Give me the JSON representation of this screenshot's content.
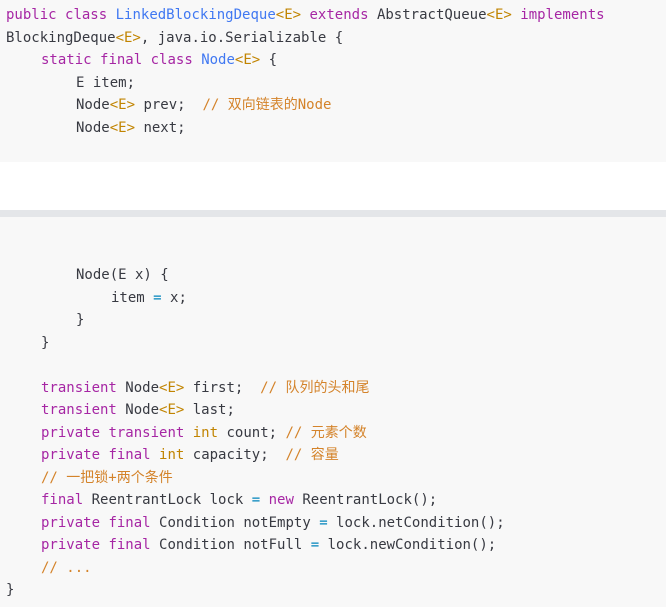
{
  "code_top": [
    {
      "indent": 0,
      "tokens": [
        {
          "t": "public",
          "c": "kw"
        },
        {
          "t": " "
        },
        {
          "t": "class",
          "c": "kw"
        },
        {
          "t": " "
        },
        {
          "t": "LinkedBlockingDeque",
          "c": "cls2"
        },
        {
          "t": "<E>",
          "c": "cls"
        },
        {
          "t": " "
        },
        {
          "t": "extends",
          "c": "kw"
        },
        {
          "t": " AbstractQueue"
        },
        {
          "t": "<E>",
          "c": "cls"
        },
        {
          "t": " "
        },
        {
          "t": "implements",
          "c": "kw"
        }
      ]
    },
    {
      "indent": 0,
      "tokens": [
        {
          "t": "BlockingDeque"
        },
        {
          "t": "<E>",
          "c": "cls"
        },
        {
          "t": ", java.io.Serializable {"
        }
      ]
    },
    {
      "indent": 1,
      "tokens": [
        {
          "t": "static",
          "c": "kw"
        },
        {
          "t": " "
        },
        {
          "t": "final",
          "c": "kw"
        },
        {
          "t": " "
        },
        {
          "t": "class",
          "c": "kw"
        },
        {
          "t": " "
        },
        {
          "t": "Node",
          "c": "cls2"
        },
        {
          "t": "<E>",
          "c": "cls"
        },
        {
          "t": " {"
        }
      ]
    },
    {
      "indent": 2,
      "tokens": [
        {
          "t": "E item;"
        }
      ]
    },
    {
      "indent": 2,
      "tokens": [
        {
          "t": "Node"
        },
        {
          "t": "<E>",
          "c": "cls"
        },
        {
          "t": " prev;  "
        },
        {
          "t": "// 双向链表的Node",
          "c": "cmt"
        }
      ]
    },
    {
      "indent": 2,
      "tokens": [
        {
          "t": "Node"
        },
        {
          "t": "<E>",
          "c": "cls"
        },
        {
          "t": " next;"
        }
      ]
    }
  ],
  "code_bottom": [
    {
      "indent": 2,
      "tokens": [
        {
          "t": "Node(E x) {"
        }
      ]
    },
    {
      "indent": 3,
      "tokens": [
        {
          "t": "item "
        },
        {
          "t": "=",
          "c": "op"
        },
        {
          "t": " x;"
        }
      ]
    },
    {
      "indent": 2,
      "tokens": [
        {
          "t": "}"
        }
      ]
    },
    {
      "indent": 1,
      "tokens": [
        {
          "t": "}"
        }
      ]
    },
    {
      "indent": 0,
      "tokens": [
        {
          "t": ""
        }
      ]
    },
    {
      "indent": 1,
      "tokens": [
        {
          "t": "transient",
          "c": "kw"
        },
        {
          "t": " Node"
        },
        {
          "t": "<E>",
          "c": "cls"
        },
        {
          "t": " first;  "
        },
        {
          "t": "// 队列的头和尾",
          "c": "cmt"
        }
      ]
    },
    {
      "indent": 1,
      "tokens": [
        {
          "t": "transient",
          "c": "kw"
        },
        {
          "t": " Node"
        },
        {
          "t": "<E>",
          "c": "cls"
        },
        {
          "t": " last;"
        }
      ]
    },
    {
      "indent": 1,
      "tokens": [
        {
          "t": "private",
          "c": "kw"
        },
        {
          "t": " "
        },
        {
          "t": "transient",
          "c": "kw"
        },
        {
          "t": " "
        },
        {
          "t": "int",
          "c": "cls"
        },
        {
          "t": " count; "
        },
        {
          "t": "// 元素个数",
          "c": "cmt"
        }
      ]
    },
    {
      "indent": 1,
      "tokens": [
        {
          "t": "private",
          "c": "kw"
        },
        {
          "t": " "
        },
        {
          "t": "final",
          "c": "kw"
        },
        {
          "t": " "
        },
        {
          "t": "int",
          "c": "cls"
        },
        {
          "t": " capacity;  "
        },
        {
          "t": "// 容量",
          "c": "cmt"
        }
      ]
    },
    {
      "indent": 1,
      "tokens": [
        {
          "t": "// 一把锁+两个条件",
          "c": "cmt"
        }
      ]
    },
    {
      "indent": 1,
      "tokens": [
        {
          "t": "final",
          "c": "kw"
        },
        {
          "t": " ReentrantLock lock "
        },
        {
          "t": "=",
          "c": "op"
        },
        {
          "t": " "
        },
        {
          "t": "new",
          "c": "kw"
        },
        {
          "t": " ReentrantLock();"
        }
      ]
    },
    {
      "indent": 1,
      "tokens": [
        {
          "t": "private",
          "c": "kw"
        },
        {
          "t": " "
        },
        {
          "t": "final",
          "c": "kw"
        },
        {
          "t": " Condition notEmpty "
        },
        {
          "t": "=",
          "c": "op"
        },
        {
          "t": " lock.netCondition();"
        }
      ]
    },
    {
      "indent": 1,
      "tokens": [
        {
          "t": "private",
          "c": "kw"
        },
        {
          "t": " "
        },
        {
          "t": "final",
          "c": "kw"
        },
        {
          "t": " Condition notFull "
        },
        {
          "t": "=",
          "c": "op"
        },
        {
          "t": " lock.newCondition();"
        }
      ]
    },
    {
      "indent": 1,
      "tokens": [
        {
          "t": "// ...",
          "c": "cmt"
        }
      ]
    },
    {
      "indent": 0,
      "tokens": [
        {
          "t": "}"
        }
      ]
    }
  ],
  "colors": {
    "keyword": "#a626a4",
    "generic": "#c18401",
    "class_name": "#4078f2",
    "comment": "#d4832a",
    "operator": "#0184bc",
    "text": "#383a42",
    "block_bg": "#f8f8f8",
    "separator": "#e4e6e9"
  }
}
